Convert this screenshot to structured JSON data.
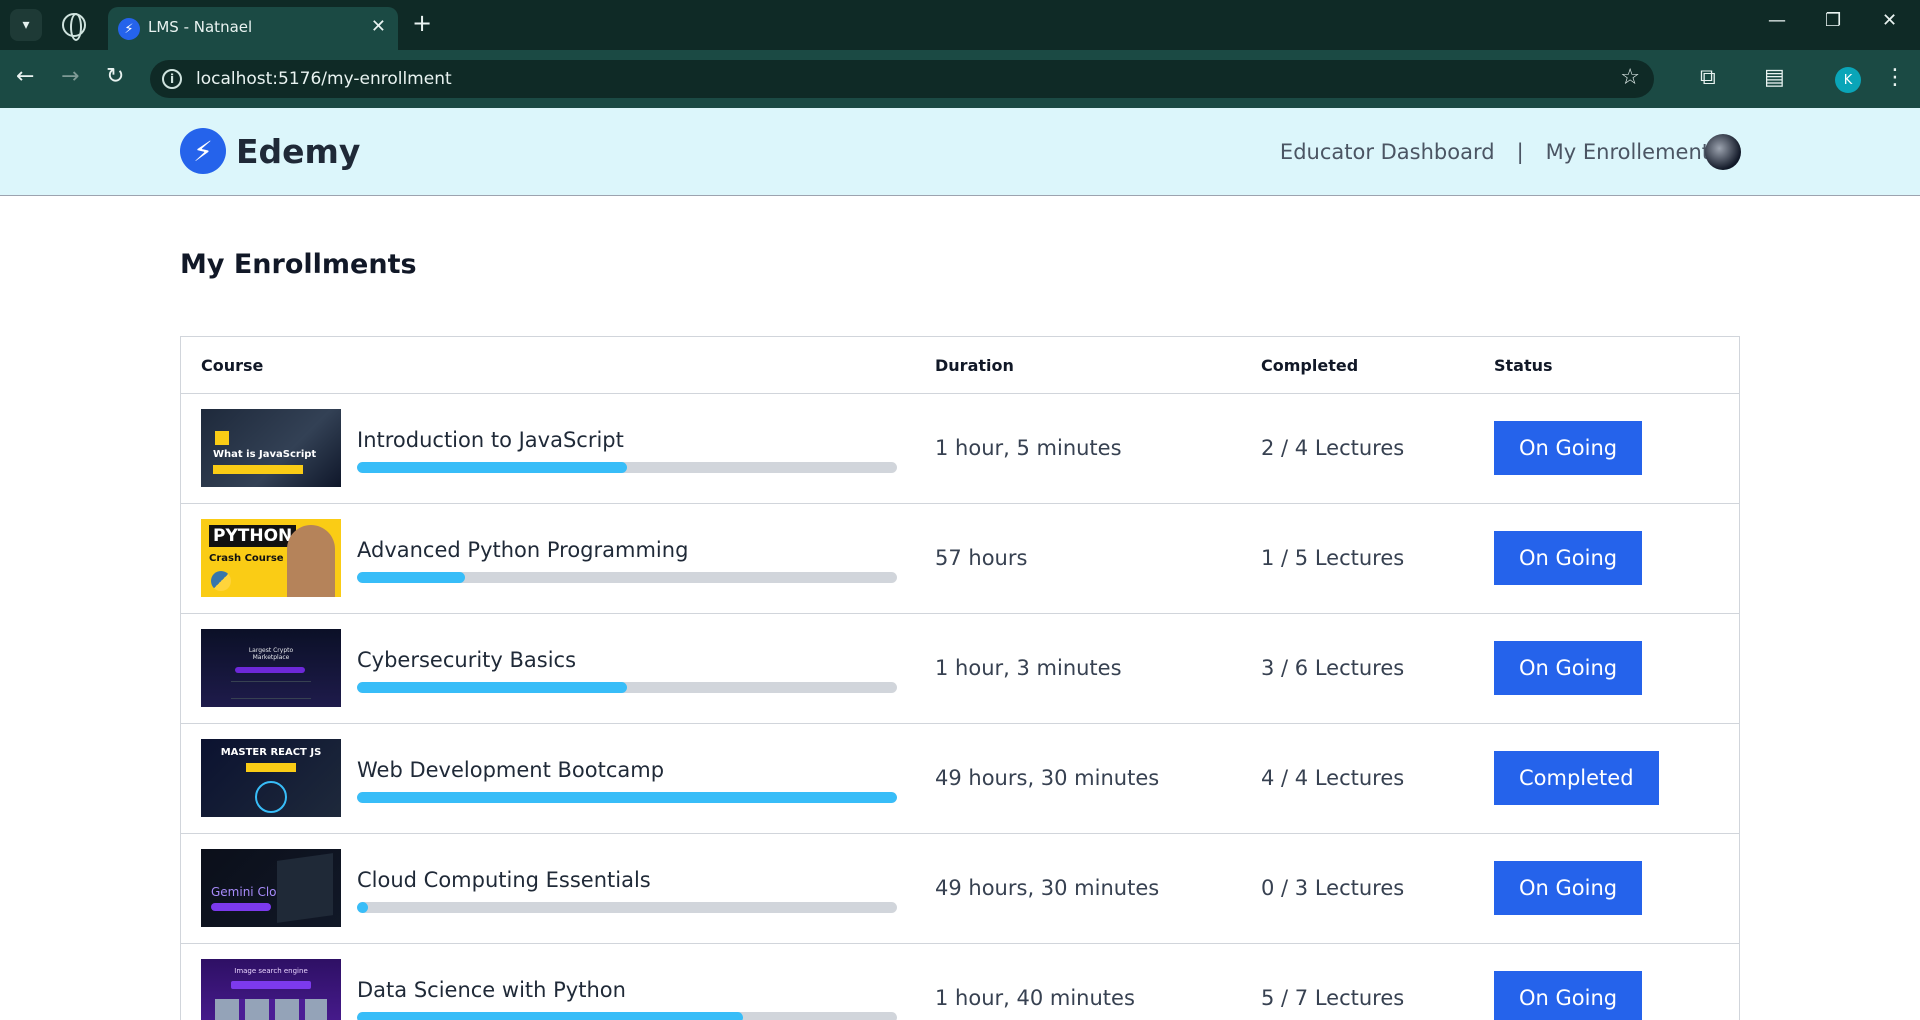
{
  "browser": {
    "tab_title": "LMS - Natnael",
    "url": "localhost:5176/my-enrollment",
    "profile_initial": "K"
  },
  "header": {
    "logo_text": "Edemy",
    "nav_educator": "Educator Dashboard",
    "nav_separator": "|",
    "nav_enrollment": "My Enrollement"
  },
  "page": {
    "title": "My Enrollments"
  },
  "table": {
    "columns": {
      "course": "Course",
      "duration": "Duration",
      "completed": "Completed",
      "status": "Status"
    },
    "rows": [
      {
        "title": "Introduction to JavaScript",
        "duration": "1 hour, 5 minutes",
        "completed": "2 / 4 Lectures",
        "status": "On Going",
        "progress": 0.5,
        "thumb_text": "What is JavaScript"
      },
      {
        "title": "Advanced Python Programming",
        "duration": "57 hours",
        "completed": "1 / 5 Lectures",
        "status": "On Going",
        "progress": 0.2,
        "thumb_text": "PYTHON",
        "thumb_sub": "Crash Course"
      },
      {
        "title": "Cybersecurity Basics",
        "duration": "1 hour, 3 minutes",
        "completed": "3 / 6 Lectures",
        "status": "On Going",
        "progress": 0.5,
        "thumb_text": "Largest Crypto Marketplace"
      },
      {
        "title": "Web Development Bootcamp",
        "duration": "49 hours, 30 minutes",
        "completed": "4 / 4 Lectures",
        "status": "Completed",
        "progress": 1.0,
        "thumb_text": "MASTER REACT JS"
      },
      {
        "title": "Cloud Computing Essentials",
        "duration": "49 hours, 30 minutes",
        "completed": "0 / 3 Lectures",
        "status": "On Going",
        "progress": 0.0,
        "thumb_text": "Gemini Clone"
      },
      {
        "title": "Data Science with Python",
        "duration": "1 hour, 40 minutes",
        "completed": "5 / 7 Lectures",
        "status": "On Going",
        "progress": 0.714,
        "thumb_text": "Image search engine"
      }
    ]
  },
  "colors": {
    "accent": "#2563eb",
    "progress_fill": "#38bdf8",
    "header_bg": "#dcf6fb"
  }
}
